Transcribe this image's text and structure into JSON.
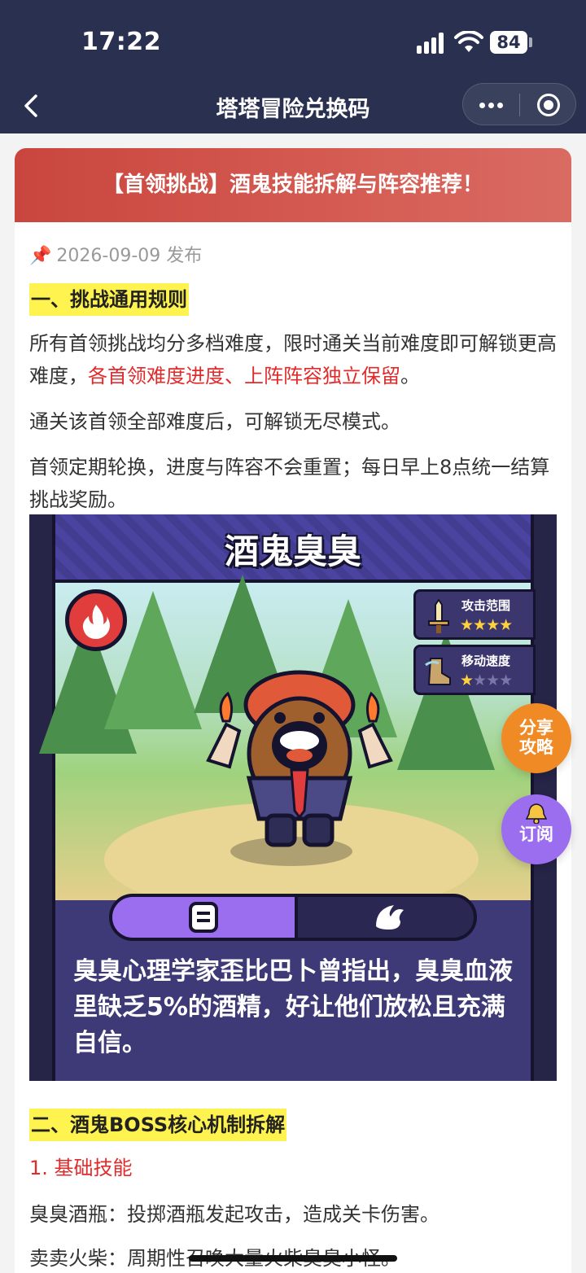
{
  "status_bar": {
    "time": "17:22",
    "battery": "84"
  },
  "nav": {
    "title": "塔塔冒险兑换码",
    "more_icon": "more-dots-icon",
    "close_icon": "target-icon"
  },
  "article": {
    "banner": "【首领挑战】酒鬼技能拆解与阵容推荐！",
    "publish_icon": "📌",
    "publish_date": "2026-09-09 发布",
    "section1": {
      "heading": "一、挑战通用规则",
      "p1_a": "所有首领挑战均分多档难度，限时通关当前难度即可解锁更高难度，",
      "p1_highlight": "各首领难度进度、上阵阵容独立保留",
      "p1_b": "。",
      "p2": "通关该首领全部难度后，可解锁无尽模式。",
      "p3": "首领定期轮换，进度与阵容不会重置；每日早上8点统一结算挑战奖励。"
    },
    "boss_card": {
      "name": "酒鬼臭臭",
      "stats": [
        {
          "label": "攻击范围",
          "rating": 4,
          "max": 4
        },
        {
          "label": "移动速度",
          "rating": 1,
          "max": 4
        }
      ],
      "description": "臭臭心理学家歪比巴卜曾指出，臭臭血液里缺乏5%的酒精，好让他们放松且充满自信。"
    },
    "section2": {
      "heading": "二、酒鬼BOSS核心机制拆解",
      "sub1": "1. 基础技能",
      "p1": "臭臭酒瓶：投掷酒瓶发起攻击，造成关卡伤害。",
      "p2": "卖卖火柴：周期性召唤大量火柴臭臭小怪。"
    }
  },
  "fab": {
    "share_line1": "分享",
    "share_line2": "攻略",
    "subscribe": "订阅"
  },
  "colors": {
    "nav_bg": "#2a3150",
    "banner": "#d45a51",
    "highlight": "#fff44f",
    "accent_red": "#e12b2b",
    "share_fab": "#f08a25",
    "subscribe_fab": "#9b6ef0"
  }
}
